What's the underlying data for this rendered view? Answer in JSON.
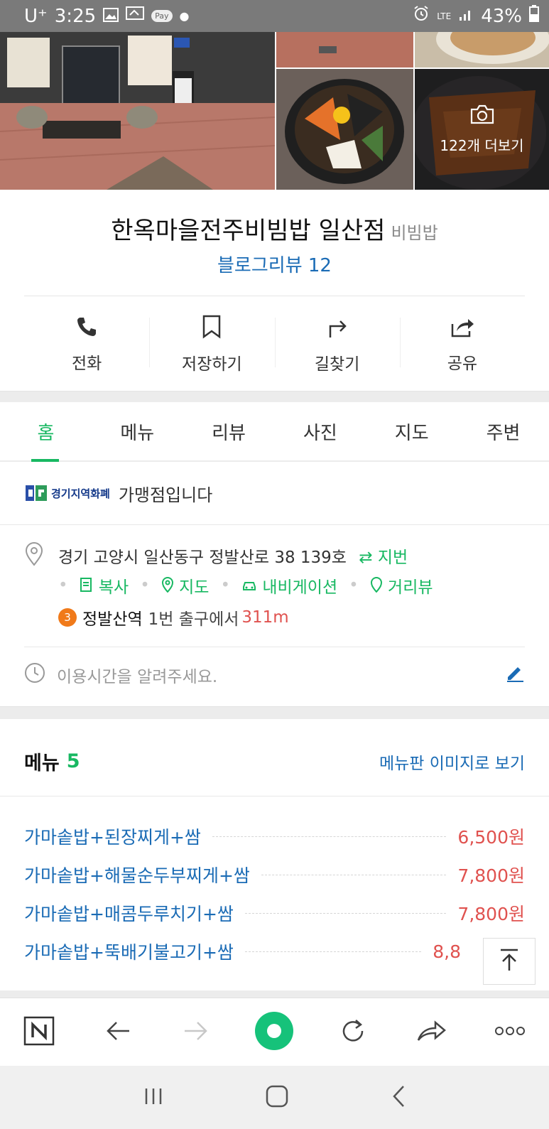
{
  "status_bar": {
    "carrier": "U⁺",
    "time": "3:25",
    "pay_label": "Pay",
    "network": "LTE",
    "battery": "43%"
  },
  "photos": {
    "more_label": "122개 더보기"
  },
  "place": {
    "name": "한옥마을전주비빔밥 일산점",
    "category": "비빔밥",
    "blog_review": "블로그리뷰 12"
  },
  "actions": [
    {
      "label": "전화",
      "icon": "phone-icon"
    },
    {
      "label": "저장하기",
      "icon": "bookmark-icon"
    },
    {
      "label": "길찾기",
      "icon": "directions-icon"
    },
    {
      "label": "공유",
      "icon": "share-icon"
    }
  ],
  "tabs": [
    "홈",
    "메뉴",
    "리뷰",
    "사진",
    "지도",
    "주변"
  ],
  "active_tab": "홈",
  "local_currency": {
    "logo_text": "경기지역화폐",
    "text": "가맹점입니다"
  },
  "info": {
    "address": "경기 고양시 일산동구 정발산로 38 139호",
    "jibun_label": "지번",
    "links": [
      "복사",
      "지도",
      "내비게이션",
      "거리뷰"
    ],
    "station_line": "3",
    "station_name": "정발산역",
    "station_exit": "1번 출구에서",
    "station_distance": "311m",
    "hours_placeholder": "이용시간을 알려주세요."
  },
  "menu": {
    "title": "메뉴",
    "count": "5",
    "board_link": "메뉴판 이미지로 보기",
    "items": [
      {
        "name": "가마솥밥+된장찌게+쌈",
        "price": "6,500원"
      },
      {
        "name": "가마솥밥+해물순두부찌게+쌈",
        "price": "7,800원"
      },
      {
        "name": "가마솥밥+매콤두루치기+쌈",
        "price": "7,800원"
      },
      {
        "name": "가마솥밥+뚝배기불고기+쌈",
        "price": "8,8"
      }
    ]
  },
  "colors": {
    "green": "#18b862",
    "blue": "#1a6bb5",
    "red": "#e0524f",
    "orange_line": "#f07a1a"
  }
}
